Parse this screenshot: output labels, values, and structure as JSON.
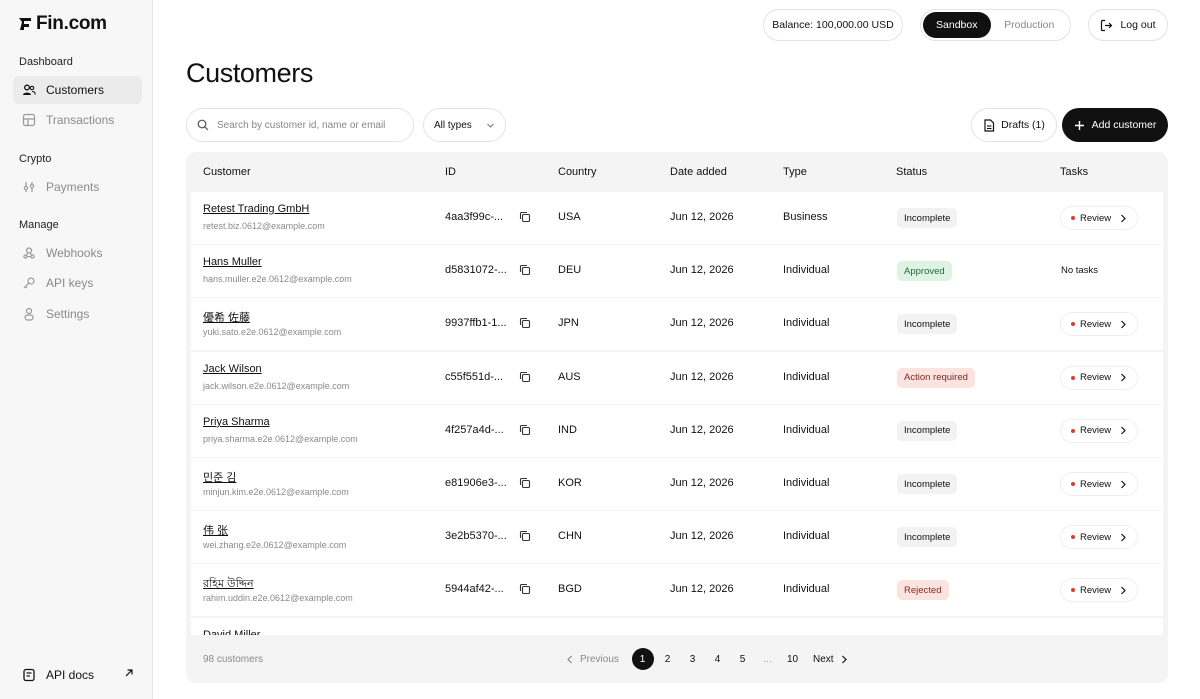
{
  "brand": {
    "name": "Fin.com"
  },
  "sidebar": {
    "sections": [
      {
        "label": "Dashboard",
        "items": [
          {
            "label": "Customers",
            "icon": "users-icon"
          },
          {
            "label": "Transactions",
            "icon": "transactions-icon"
          }
        ]
      },
      {
        "label": "Crypto",
        "items": [
          {
            "label": "Payments",
            "icon": "payments-icon"
          }
        ]
      },
      {
        "label": "Manage",
        "items": [
          {
            "label": "Webhooks",
            "icon": "webhook-icon"
          },
          {
            "label": "API keys",
            "icon": "key-icon"
          },
          {
            "label": "Settings",
            "icon": "person-icon"
          }
        ]
      }
    ],
    "active": "Customers",
    "api_docs": "API docs"
  },
  "header": {
    "balance": "Balance: 100,000.00 USD",
    "env_options": [
      "Sandbox",
      "Production"
    ],
    "env_selected": "Sandbox",
    "logout": "Log out"
  },
  "page": {
    "title": "Customers"
  },
  "toolbar": {
    "search_placeholder": "Search by customer id, name or email",
    "type_filter": "All types",
    "drafts": "Drafts (1)",
    "add_customer": "Add customer"
  },
  "table": {
    "columns": [
      "Customer",
      "ID",
      "Country",
      "Date added",
      "Type",
      "Status",
      "Tasks"
    ],
    "rows": [
      {
        "name": "Retest Trading GmbH",
        "email": "retest.biz.0612@example.com",
        "id": "4aa3f99c-...",
        "country": "USA",
        "date": "Jun 12, 2026",
        "type": "Business",
        "status": "Incomplete",
        "task": "Review"
      },
      {
        "name": "Hans Muller",
        "email": "hans.muller.e2e.0612@example.com",
        "id": "d5831072-...",
        "country": "DEU",
        "date": "Jun 12, 2026",
        "type": "Individual",
        "status": "Approved",
        "task": "No tasks"
      },
      {
        "name": "優希 佐藤",
        "email": "yuki.sato.e2e.0612@example.com",
        "id": "9937ffb1-1...",
        "country": "JPN",
        "date": "Jun 12, 2026",
        "type": "Individual",
        "status": "Incomplete",
        "task": "Review"
      },
      {
        "name": "Jack Wilson",
        "email": "jack.wilson.e2e.0612@example.com",
        "id": "c55f551d-...",
        "country": "AUS",
        "date": "Jun 12, 2026",
        "type": "Individual",
        "status": "Action required",
        "task": "Review"
      },
      {
        "name": "Priya Sharma",
        "email": "priya.sharma.e2e.0612@example.com",
        "id": "4f257a4d-...",
        "country": "IND",
        "date": "Jun 12, 2026",
        "type": "Individual",
        "status": "Incomplete",
        "task": "Review"
      },
      {
        "name": "민준 김",
        "email": "minjun.kim.e2e.0612@example.com",
        "id": "e81906e3-...",
        "country": "KOR",
        "date": "Jun 12, 2026",
        "type": "Individual",
        "status": "Incomplete",
        "task": "Review"
      },
      {
        "name": "伟 张",
        "email": "wei.zhang.e2e.0612@example.com",
        "id": "3e2b5370-...",
        "country": "CHN",
        "date": "Jun 12, 2026",
        "type": "Individual",
        "status": "Incomplete",
        "task": "Review"
      },
      {
        "name": "রহিম উদ্দিন",
        "email": "rahim.uddin.e2e.0612@example.com",
        "id": "5944af42-...",
        "country": "BGD",
        "date": "Jun 12, 2026",
        "type": "Individual",
        "status": "Rejected",
        "task": "Review"
      },
      {
        "name": "David Miller",
        "email": "",
        "id": "",
        "country": "",
        "date": "",
        "type": "",
        "status": "",
        "task": ""
      }
    ]
  },
  "footer": {
    "count": "98 customers",
    "prev": "Previous",
    "next": "Next",
    "pages": [
      "1",
      "2",
      "3",
      "4",
      "5",
      "...",
      "10"
    ],
    "current_page": "1"
  },
  "colors": {
    "status_incomplete_bg": "#f2f2f2",
    "status_approved_bg": "#dff3e4",
    "status_action_bg": "#fbe3df",
    "status_rejected_bg": "#fbe3df",
    "task_dot": "#e53935",
    "primary": "#111111"
  }
}
